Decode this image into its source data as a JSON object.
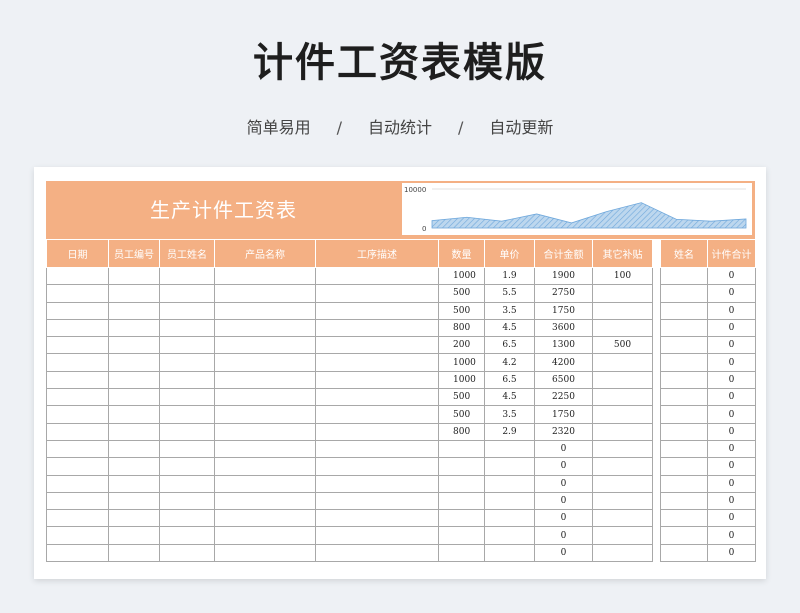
{
  "header": {
    "title": "计件工资表模版",
    "tags": [
      "简单易用",
      "自动统计",
      "自动更新"
    ],
    "separator": "/"
  },
  "sheet": {
    "banner_title": "生产计件工资表",
    "columns_left": [
      "日期",
      "员工编号",
      "员工姓名",
      "产品名称",
      "工序描述",
      "数量",
      "单价",
      "合计金额",
      "其它补贴"
    ],
    "columns_right": [
      "姓名",
      "计件合计"
    ],
    "rows": [
      {
        "qty": "1000",
        "price": "1.9",
        "total": "1900",
        "subsidy": "100",
        "piece_total": "0"
      },
      {
        "qty": "500",
        "price": "5.5",
        "total": "2750",
        "subsidy": "",
        "piece_total": "0"
      },
      {
        "qty": "500",
        "price": "3.5",
        "total": "1750",
        "subsidy": "",
        "piece_total": "0"
      },
      {
        "qty": "800",
        "price": "4.5",
        "total": "3600",
        "subsidy": "",
        "piece_total": "0"
      },
      {
        "qty": "200",
        "price": "6.5",
        "total": "1300",
        "subsidy": "500",
        "piece_total": "0"
      },
      {
        "qty": "1000",
        "price": "4.2",
        "total": "4200",
        "subsidy": "",
        "piece_total": "0"
      },
      {
        "qty": "1000",
        "price": "6.5",
        "total": "6500",
        "subsidy": "",
        "piece_total": "0"
      },
      {
        "qty": "500",
        "price": "4.5",
        "total": "2250",
        "subsidy": "",
        "piece_total": "0"
      },
      {
        "qty": "500",
        "price": "3.5",
        "total": "1750",
        "subsidy": "",
        "piece_total": "0"
      },
      {
        "qty": "800",
        "price": "2.9",
        "total": "2320",
        "subsidy": "",
        "piece_total": "0"
      },
      {
        "qty": "",
        "price": "",
        "total": "0",
        "subsidy": "",
        "piece_total": "0"
      },
      {
        "qty": "",
        "price": "",
        "total": "0",
        "subsidy": "",
        "piece_total": "0"
      },
      {
        "qty": "",
        "price": "",
        "total": "0",
        "subsidy": "",
        "piece_total": "0"
      },
      {
        "qty": "",
        "price": "",
        "total": "0",
        "subsidy": "",
        "piece_total": "0"
      },
      {
        "qty": "",
        "price": "",
        "total": "0",
        "subsidy": "",
        "piece_total": "0"
      },
      {
        "qty": "",
        "price": "",
        "total": "0",
        "subsidy": "",
        "piece_total": "0"
      },
      {
        "qty": "",
        "price": "",
        "total": "0",
        "subsidy": "",
        "piece_total": "0"
      }
    ]
  },
  "chart_data": {
    "type": "area",
    "ylim": [
      0,
      10000
    ],
    "y_tick_labels": [
      "10000",
      "0"
    ],
    "values": [
      1900,
      2750,
      1750,
      3600,
      1300,
      4200,
      6500,
      2250,
      1750,
      2320
    ],
    "colors": {
      "fill": "#bdd7ee",
      "stroke": "#6fa8dc",
      "accent": "#f4b084"
    }
  }
}
